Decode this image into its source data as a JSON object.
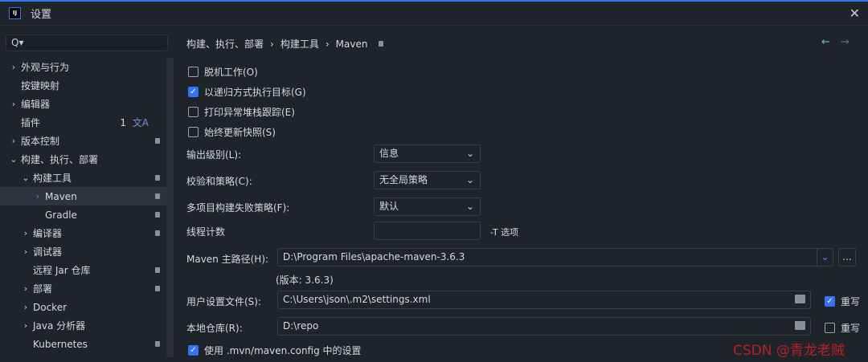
{
  "window": {
    "title": "设置",
    "logo": "IJ",
    "close": "✕"
  },
  "search": {
    "icon": "Q▾"
  },
  "tree": [
    {
      "label": "外观与行为",
      "arrow": "›",
      "indent": 0
    },
    {
      "label": "按键映射",
      "arrow": "",
      "indent": 0
    },
    {
      "label": "编辑器",
      "arrow": "›",
      "indent": 0
    },
    {
      "label": "插件",
      "arrow": "",
      "indent": 0,
      "count": "1"
    },
    {
      "label": "版本控制",
      "arrow": "›",
      "indent": 0,
      "badge": true
    },
    {
      "label": "构建、执行、部署",
      "arrow": "⌄",
      "indent": 0
    },
    {
      "label": "构建工具",
      "arrow": "⌄",
      "indent": 1,
      "badge": true
    },
    {
      "label": "Maven",
      "arrow": "›",
      "indent": 2,
      "badge": true,
      "selected": true
    },
    {
      "label": "Gradle",
      "arrow": "",
      "indent": 2,
      "badge": true
    },
    {
      "label": "编译器",
      "arrow": "›",
      "indent": 1,
      "badge": true
    },
    {
      "label": "调试器",
      "arrow": "›",
      "indent": 1
    },
    {
      "label": "远程 Jar 仓库",
      "arrow": "",
      "indent": 1,
      "badge": true
    },
    {
      "label": "部署",
      "arrow": "›",
      "indent": 1,
      "badge": true
    },
    {
      "label": "Docker",
      "arrow": "›",
      "indent": 1
    },
    {
      "label": "Java 分析器",
      "arrow": "›",
      "indent": 1
    },
    {
      "label": "Kubernetes",
      "arrow": "",
      "indent": 1,
      "badge": true
    }
  ],
  "breadcrumb": [
    "构建、执行、部署",
    "构建工具",
    "Maven"
  ],
  "breadcrumb_sep": "›",
  "nav": {
    "back": "←",
    "forward": "→"
  },
  "checkboxes": [
    {
      "label": "脱机工作(O)",
      "checked": false
    },
    {
      "label": "以递归方式执行目标(G)",
      "checked": true
    },
    {
      "label": "打印异常堆栈跟踪(E)",
      "checked": false
    },
    {
      "label": "始终更新快照(S)",
      "checked": false
    }
  ],
  "selects": [
    {
      "label": "输出级别(L):",
      "value": "信息"
    },
    {
      "label": "校验和策略(C):",
      "value": "无全局策略"
    },
    {
      "label": "多项目构建失败策略(F):",
      "value": "默认"
    }
  ],
  "threads": {
    "label": "线程计数",
    "value": "",
    "hint": "-T 选项"
  },
  "maven_home": {
    "label": "Maven 主路径(H):",
    "value": "D:\\Program Files\\apache-maven-3.6.3",
    "browse": "...",
    "version": "(版本: 3.6.3)"
  },
  "user_settings": {
    "label": "用户设置文件(S):",
    "value": "C:\\Users\\json\\.m2\\settings.xml",
    "override": "重写",
    "override_checked": true
  },
  "local_repo": {
    "label": "本地仓库(R):",
    "value": "D:\\repo",
    "override": "重写",
    "override_checked": false
  },
  "use_mvn_config": {
    "label": "使用 .mvn/maven.config 中的设置",
    "checked": true
  },
  "watermark": "CSDN @青龙老贼"
}
